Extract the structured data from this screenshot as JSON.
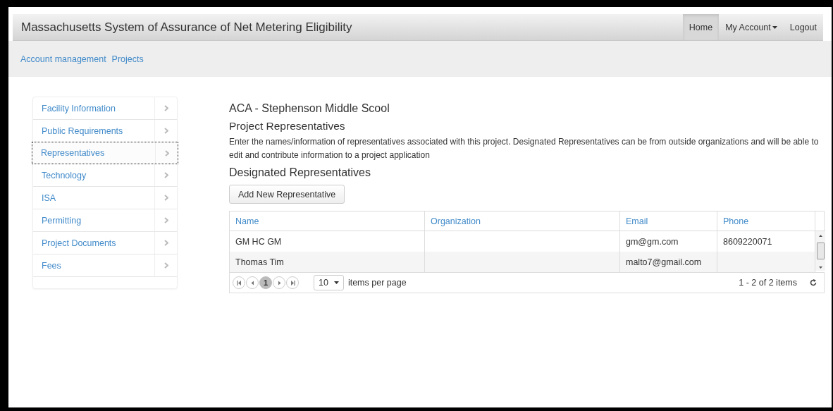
{
  "navbar": {
    "brand": "Massachusetts System of Assurance of Net Metering Eligibility",
    "items": [
      {
        "label": "Home",
        "selected": true,
        "kind": "link"
      },
      {
        "label": "My Account",
        "selected": false,
        "kind": "dropdown"
      },
      {
        "label": "Logout",
        "selected": false,
        "kind": "link"
      }
    ]
  },
  "breadcrumbs": [
    "Account management",
    "Projects"
  ],
  "sidebar": {
    "items": [
      {
        "label": "Facility Information",
        "selected": false
      },
      {
        "label": "Public Requirements",
        "selected": false
      },
      {
        "label": "Representatives",
        "selected": true
      },
      {
        "label": "Technology",
        "selected": false
      },
      {
        "label": "ISA",
        "selected": false
      },
      {
        "label": "Permitting",
        "selected": false
      },
      {
        "label": "Project Documents",
        "selected": false
      },
      {
        "label": "Fees",
        "selected": false
      }
    ]
  },
  "project_title": "ACA - Stephenson Middle Scool",
  "section_title": "Project Representatives",
  "description": "Enter the names/information of representatives associated with this project. Designated Representatives can be from outside organizations and will be able to edit and contribute information to a project application",
  "subsection_title": "Designated Representatives",
  "add_button": "Add New Representative",
  "table": {
    "columns": [
      "Name",
      "Organization",
      "Email",
      "Phone"
    ],
    "rows": [
      [
        "GM HC GM",
        "",
        "gm@gm.com",
        "8609220071"
      ],
      [
        "Thomas Tim",
        "",
        "malto7@gmail.com",
        ""
      ]
    ]
  },
  "pager": {
    "pages": [
      {
        "label": "1",
        "selected": true
      }
    ],
    "page_size": "10",
    "page_size_label": "items per page",
    "info": "1 - 2 of 2 items"
  }
}
